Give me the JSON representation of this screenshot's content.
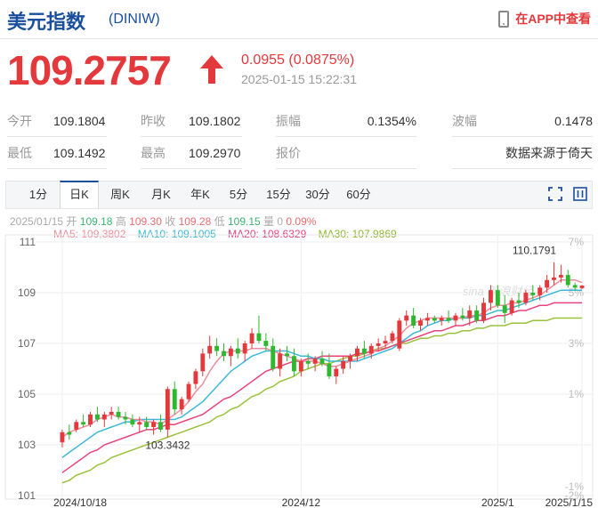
{
  "header": {
    "name": "美元指数",
    "code": "(DINIW)",
    "app_link": "在APP中查看"
  },
  "quote": {
    "price": "109.2757",
    "change": "0.0955 (0.0875%)",
    "datetime": "2025-01-15 15:22:31"
  },
  "stats": {
    "row1": [
      {
        "label": "今开",
        "value": "109.1804"
      },
      {
        "label": "昨收",
        "value": "109.1802"
      },
      {
        "label": "振幅",
        "value": "0.1354%"
      },
      {
        "label": "波幅",
        "value": "0.1478"
      }
    ],
    "row2": [
      {
        "label": "最低",
        "value": "109.1492"
      },
      {
        "label": "最高",
        "value": "109.2970"
      },
      {
        "label": "报价",
        "value": ""
      },
      {
        "label": "",
        "value": "数据来源于倚天"
      }
    ]
  },
  "tabs": [
    "1分",
    "日K",
    "周K",
    "月K",
    "年K",
    "5分",
    "15分",
    "30分",
    "60分"
  ],
  "active_tab": "日K",
  "ohlc": {
    "date": "2025/01/15",
    "open_label": "开",
    "open": "109.18",
    "high_label": "高",
    "high": "109.30",
    "close_label": "收",
    "close": "109.28",
    "low_label": "低",
    "low": "109.15",
    "vol_label": "量",
    "vol": "0",
    "pct": "0.09%"
  },
  "ma": {
    "ma5": "MA5: 109.3802",
    "ma10": "MA10: 109.1005",
    "ma20": "MA20: 108.6329",
    "ma30": "MA30: 107.9869"
  },
  "colors": {
    "up": "#e4393c",
    "down": "#2eb82e",
    "ma5": "#f08c9c",
    "ma10": "#3cb8d8",
    "ma20": "#e8437a",
    "ma30": "#9ac23c",
    "accent": "#1a4f9c"
  },
  "chart_data": {
    "type": "candlestick",
    "y_ticks": [
      "111",
      "109",
      "107",
      "105",
      "103",
      "101"
    ],
    "y_range": [
      101,
      111
    ],
    "pct_ticks": [
      "7%",
      "5%",
      "3%",
      "1%",
      "-1%",
      "-2%"
    ],
    "x_ticks": [
      "2024/10/18",
      "2024/12",
      "2025/1",
      "2025/1/15"
    ],
    "annotations": {
      "high": "110.1791",
      "low": "103.3432"
    },
    "watermark": "sina 新浪财经",
    "candles": [
      [
        103.1,
        103.6,
        102.9,
        103.5
      ],
      [
        103.5,
        103.8,
        103.2,
        103.4
      ],
      [
        103.6,
        104.0,
        103.5,
        103.9
      ],
      [
        103.9,
        104.2,
        103.7,
        103.8
      ],
      [
        103.8,
        104.3,
        103.7,
        104.2
      ],
      [
        104.2,
        104.5,
        103.9,
        104.0
      ],
      [
        104.0,
        104.3,
        103.7,
        104.2
      ],
      [
        104.2,
        104.5,
        104.0,
        104.3
      ],
      [
        104.3,
        104.5,
        104.0,
        104.1
      ],
      [
        104.1,
        104.3,
        103.8,
        104.0
      ],
      [
        104.0,
        104.2,
        103.7,
        103.8
      ],
      [
        103.8,
        104.1,
        103.5,
        103.9
      ],
      [
        103.9,
        104.1,
        103.6,
        103.7
      ],
      [
        103.7,
        104.0,
        103.4,
        103.9
      ],
      [
        103.9,
        104.2,
        103.5,
        103.6
      ],
      [
        103.6,
        105.3,
        103.3,
        105.2
      ],
      [
        105.2,
        105.5,
        104.2,
        104.4
      ],
      [
        104.4,
        104.9,
        104.2,
        104.8
      ],
      [
        104.8,
        105.5,
        104.7,
        105.4
      ],
      [
        105.4,
        106.0,
        105.2,
        105.9
      ],
      [
        105.9,
        106.8,
        105.7,
        106.6
      ],
      [
        106.6,
        107.3,
        106.4,
        106.9
      ],
      [
        106.9,
        107.2,
        106.5,
        106.7
      ],
      [
        106.7,
        107.0,
        106.3,
        106.5
      ],
      [
        106.5,
        106.9,
        106.1,
        106.8
      ],
      [
        106.8,
        107.2,
        106.4,
        106.6
      ],
      [
        106.6,
        107.1,
        106.3,
        107.0
      ],
      [
        107.0,
        107.6,
        106.8,
        107.4
      ],
      [
        107.4,
        108.1,
        107.0,
        107.1
      ],
      [
        107.1,
        107.4,
        106.7,
        106.9
      ],
      [
        106.9,
        107.2,
        105.9,
        106.0
      ],
      [
        106.0,
        106.8,
        105.7,
        106.6
      ],
      [
        106.6,
        106.9,
        106.3,
        106.5
      ],
      [
        106.5,
        106.8,
        105.7,
        105.9
      ],
      [
        105.9,
        106.4,
        105.7,
        106.3
      ],
      [
        106.3,
        106.6,
        106.0,
        106.2
      ],
      [
        106.2,
        106.5,
        105.9,
        106.4
      ],
      [
        106.4,
        106.7,
        106.1,
        106.2
      ],
      [
        106.2,
        106.6,
        105.6,
        105.7
      ],
      [
        105.7,
        106.1,
        105.4,
        106.0
      ],
      [
        106.0,
        106.5,
        105.8,
        106.3
      ],
      [
        106.3,
        106.6,
        106.0,
        106.5
      ],
      [
        106.5,
        106.9,
        106.3,
        106.8
      ],
      [
        106.8,
        107.1,
        106.4,
        106.6
      ],
      [
        106.6,
        107.0,
        106.4,
        106.9
      ],
      [
        106.9,
        107.2,
        106.7,
        107.0
      ],
      [
        107.0,
        107.3,
        106.8,
        107.1
      ],
      [
        107.1,
        107.5,
        107.0,
        107.4
      ],
      [
        106.8,
        108.0,
        106.7,
        107.9
      ],
      [
        107.9,
        108.3,
        107.7,
        108.1
      ],
      [
        108.1,
        108.4,
        107.6,
        107.7
      ],
      [
        107.7,
        108.0,
        107.5,
        107.9
      ],
      [
        107.9,
        108.2,
        107.7,
        108.0
      ],
      [
        108.0,
        108.1,
        107.8,
        107.9
      ],
      [
        107.9,
        108.1,
        107.7,
        108.0
      ],
      [
        108.0,
        108.3,
        107.8,
        107.9
      ],
      [
        107.9,
        108.2,
        107.7,
        108.1
      ],
      [
        108.1,
        108.4,
        107.9,
        108.0
      ],
      [
        108.0,
        108.5,
        107.7,
        108.3
      ],
      [
        108.3,
        108.5,
        107.8,
        107.9
      ],
      [
        107.9,
        108.8,
        107.8,
        108.6
      ],
      [
        108.6,
        109.3,
        108.3,
        109.1
      ],
      [
        109.1,
        109.3,
        108.4,
        108.5
      ],
      [
        108.5,
        108.9,
        107.8,
        108.2
      ],
      [
        108.2,
        108.8,
        108.1,
        108.7
      ],
      [
        108.7,
        109.0,
        108.4,
        108.6
      ],
      [
        108.6,
        109.1,
        108.5,
        109.0
      ],
      [
        109.0,
        109.3,
        108.7,
        108.9
      ],
      [
        108.9,
        109.3,
        108.7,
        109.2
      ],
      [
        109.2,
        109.7,
        109.0,
        109.5
      ],
      [
        109.5,
        110.2,
        109.3,
        109.6
      ],
      [
        109.6,
        110.1,
        109.4,
        109.7
      ],
      [
        109.7,
        109.9,
        109.2,
        109.3
      ],
      [
        109.3,
        109.4,
        109.1,
        109.2
      ],
      [
        109.18,
        109.3,
        109.15,
        109.28
      ]
    ],
    "ma5": [
      103.3,
      103.5,
      103.6,
      103.7,
      103.8,
      104.0,
      104.1,
      104.2,
      104.1,
      104.1,
      104.0,
      104.0,
      103.9,
      103.9,
      103.8,
      104.0,
      104.2,
      104.4,
      104.7,
      105.1,
      105.4,
      105.9,
      106.3,
      106.6,
      106.7,
      106.7,
      106.7,
      106.8,
      106.8,
      106.8,
      106.7,
      106.6,
      106.5,
      106.4,
      106.3,
      106.3,
      106.3,
      106.2,
      106.1,
      106.1,
      106.2,
      106.3,
      106.4,
      106.5,
      106.6,
      106.8,
      106.9,
      107.1,
      107.3,
      107.6,
      107.8,
      107.9,
      108.0,
      108.0,
      108.0,
      108.0,
      108.0,
      108.0,
      108.1,
      108.1,
      108.2,
      108.4,
      108.5,
      108.5,
      108.6,
      108.6,
      108.7,
      108.8,
      108.9,
      109.1,
      109.3,
      109.5,
      109.5,
      109.5,
      109.4
    ],
    "ma10": [
      102.5,
      102.7,
      102.9,
      103.1,
      103.3,
      103.5,
      103.6,
      103.7,
      103.8,
      103.9,
      103.9,
      104.0,
      104.0,
      104.0,
      104.0,
      104.0,
      104.0,
      104.1,
      104.3,
      104.5,
      104.7,
      105.0,
      105.3,
      105.6,
      105.9,
      106.1,
      106.3,
      106.5,
      106.6,
      106.7,
      106.7,
      106.7,
      106.7,
      106.6,
      106.5,
      106.5,
      106.4,
      106.4,
      106.3,
      106.3,
      106.3,
      106.3,
      106.3,
      106.4,
      106.5,
      106.6,
      106.7,
      106.8,
      107.0,
      107.2,
      107.4,
      107.5,
      107.7,
      107.8,
      107.9,
      107.9,
      108.0,
      108.0,
      108.0,
      108.1,
      108.1,
      108.2,
      108.3,
      108.3,
      108.4,
      108.5,
      108.6,
      108.7,
      108.8,
      108.9,
      109.0,
      109.1,
      109.1,
      109.1,
      109.1
    ],
    "ma20": [
      101.9,
      102.1,
      102.3,
      102.5,
      102.7,
      102.8,
      103.0,
      103.1,
      103.2,
      103.3,
      103.4,
      103.5,
      103.6,
      103.6,
      103.7,
      103.8,
      103.8,
      103.9,
      104.0,
      104.1,
      104.2,
      104.4,
      104.6,
      104.8,
      104.9,
      105.1,
      105.3,
      105.5,
      105.7,
      105.9,
      106.0,
      106.1,
      106.2,
      106.3,
      106.3,
      106.4,
      106.4,
      106.5,
      106.5,
      106.5,
      106.5,
      106.5,
      106.6,
      106.6,
      106.7,
      106.7,
      106.8,
      106.9,
      107.0,
      107.1,
      107.2,
      107.3,
      107.4,
      107.5,
      107.5,
      107.6,
      107.7,
      107.7,
      107.8,
      107.9,
      107.9,
      108.0,
      108.1,
      108.1,
      108.2,
      108.3,
      108.3,
      108.4,
      108.5,
      108.5,
      108.6,
      108.6,
      108.6,
      108.6,
      108.6
    ],
    "ma30": [
      101.5,
      101.6,
      101.8,
      101.9,
      102.0,
      102.2,
      102.3,
      102.5,
      102.6,
      102.7,
      102.8,
      102.9,
      103.0,
      103.1,
      103.2,
      103.3,
      103.4,
      103.5,
      103.6,
      103.7,
      103.8,
      103.9,
      104.1,
      104.2,
      104.4,
      104.5,
      104.7,
      104.9,
      105.0,
      105.2,
      105.3,
      105.5,
      105.6,
      105.7,
      105.9,
      106.0,
      106.1,
      106.2,
      106.2,
      106.3,
      106.4,
      106.5,
      106.5,
      106.6,
      106.7,
      106.8,
      106.8,
      106.9,
      107.0,
      107.0,
      107.1,
      107.2,
      107.2,
      107.3,
      107.3,
      107.4,
      107.4,
      107.5,
      107.5,
      107.6,
      107.6,
      107.7,
      107.7,
      107.7,
      107.8,
      107.8,
      107.8,
      107.9,
      107.9,
      107.9,
      108.0,
      108.0,
      108.0,
      108.0,
      108.0
    ]
  }
}
